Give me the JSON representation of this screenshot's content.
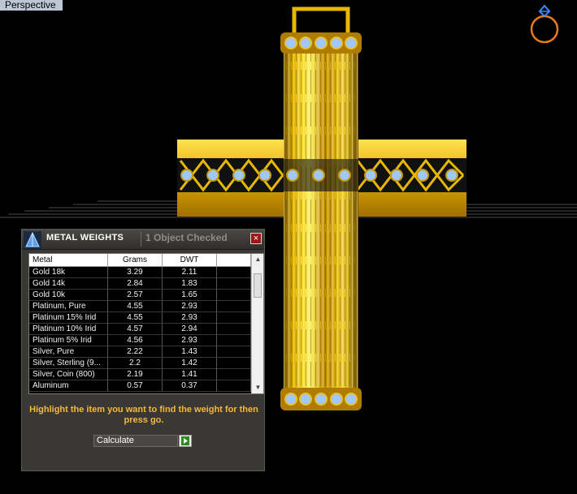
{
  "viewport": {
    "label": "Perspective",
    "ring_icon": "ring-icon"
  },
  "panel": {
    "title": "METAL WEIGHTS",
    "status": "1 Object Checked",
    "close_label": "×",
    "logo_icon": "pyramid-logo-icon",
    "table": {
      "headers": [
        "Metal",
        "Grams",
        "DWT",
        ""
      ],
      "rows": [
        {
          "metal": "Gold 18k",
          "grams": "3.29",
          "dwt": "2.11"
        },
        {
          "metal": "Gold 14k",
          "grams": "2.84",
          "dwt": "1.83"
        },
        {
          "metal": "Gold 10k",
          "grams": "2.57",
          "dwt": "1.65"
        },
        {
          "metal": "Platinum, Pure",
          "grams": "4.55",
          "dwt": "2.93"
        },
        {
          "metal": "Platinum 15% Irid",
          "grams": "4.55",
          "dwt": "2.93"
        },
        {
          "metal": "Platinum 10% Irid",
          "grams": "4.57",
          "dwt": "2.94"
        },
        {
          "metal": "Platinum 5% Irid",
          "grams": "4.56",
          "dwt": "2.93"
        },
        {
          "metal": "Silver, Pure",
          "grams": "2.22",
          "dwt": "1.43"
        },
        {
          "metal": "Silver, Sterling (9...",
          "grams": "2.2",
          "dwt": "1.42"
        },
        {
          "metal": "Silver, Coin (800)",
          "grams": "2.19",
          "dwt": "1.41"
        },
        {
          "metal": "Aluminum",
          "grams": "0.57",
          "dwt": "0.37"
        }
      ]
    },
    "hint": "Highlight the item you want to find the weight for then press go.",
    "calc_select_value": "Calculate",
    "go_icon": "play-arrow-icon"
  },
  "colors": {
    "gold": "#e8b800",
    "gem": "#9fc8ff",
    "hint": "#f4b83c",
    "close": "#9a1818"
  }
}
